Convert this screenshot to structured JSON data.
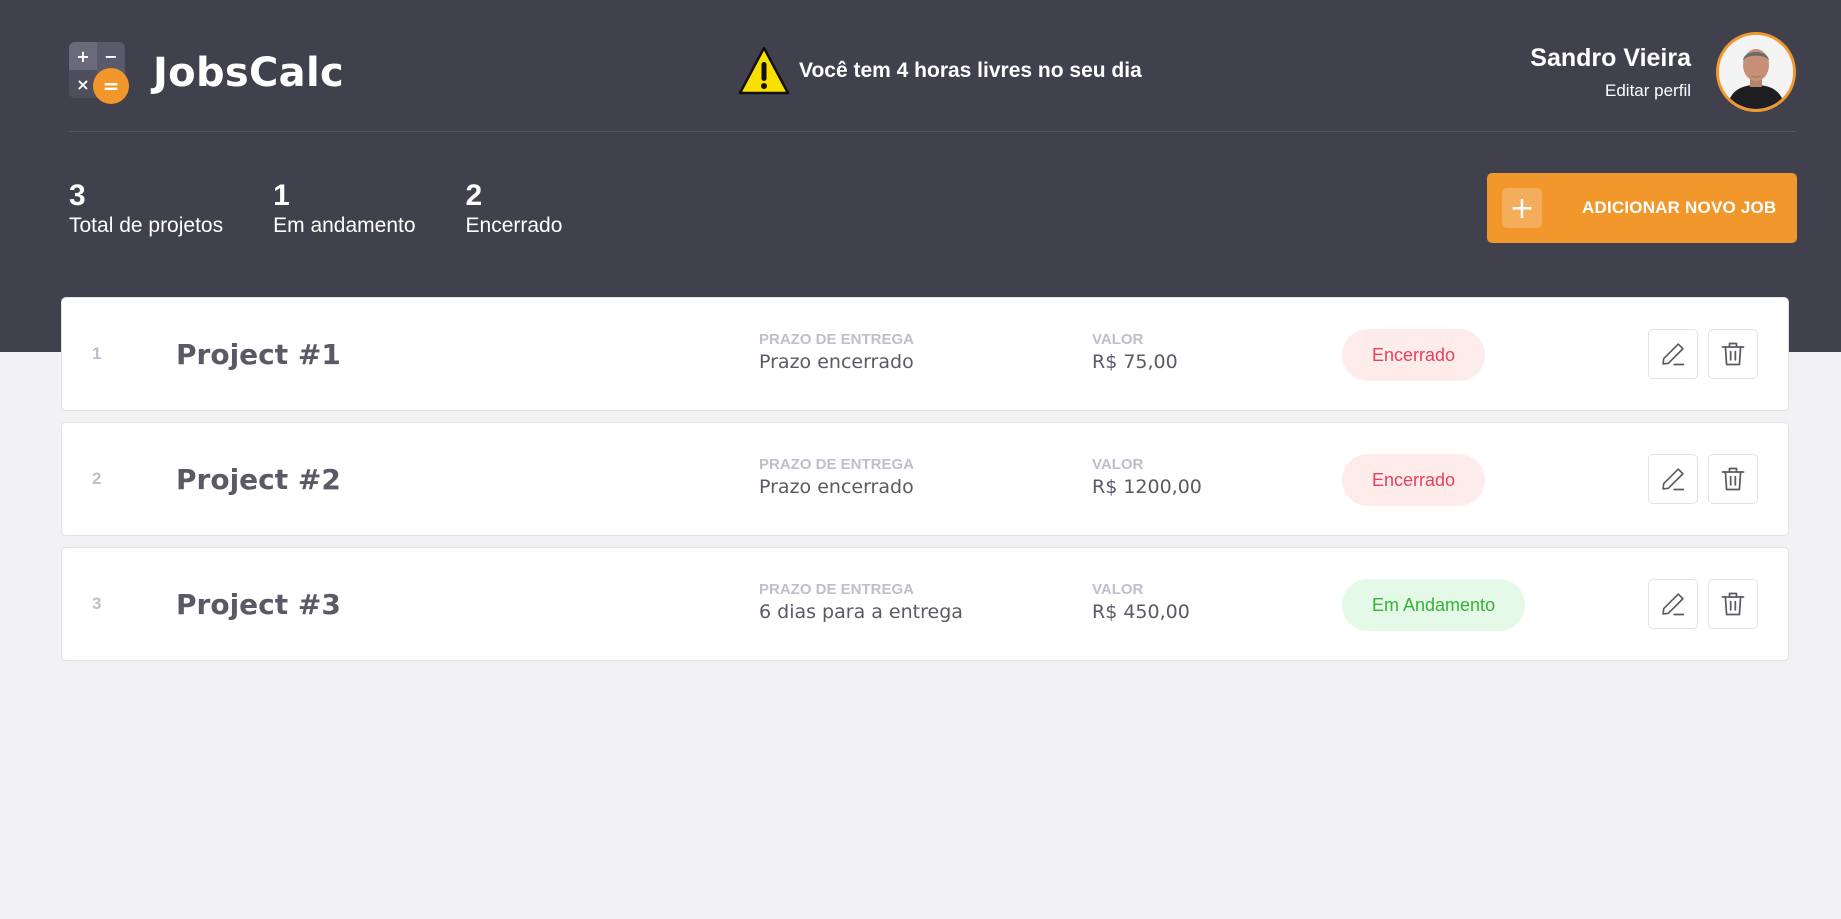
{
  "brand": {
    "name": "JobsCalc"
  },
  "alert": {
    "text": "Você tem 4 horas livres no seu dia"
  },
  "profile": {
    "name": "Sandro Vieira",
    "edit_label": "Editar perfil"
  },
  "summary": [
    {
      "value": "3",
      "label": "Total de projetos"
    },
    {
      "value": "1",
      "label": "Em andamento"
    },
    {
      "value": "2",
      "label": "Encerrado"
    }
  ],
  "actions": {
    "add_job_label": "ADICIONAR NOVO JOB"
  },
  "colors": {
    "header": "#41414d",
    "accent": "#f1972c",
    "closed": "#e83f5b",
    "in_progress": "#36b336"
  },
  "jobs": [
    {
      "id": "1",
      "name": "Project #1",
      "deadline_label": "PRAZO DE ENTREGA",
      "deadline": "Prazo encerrado",
      "value_label": "VALOR",
      "value": "R$ 75,00",
      "status": "Encerrado"
    },
    {
      "id": "2",
      "name": "Project #2",
      "deadline_label": "PRAZO DE ENTREGA",
      "deadline": "Prazo encerrado",
      "value_label": "VALOR",
      "value": "R$ 1200,00",
      "status": "Encerrado"
    },
    {
      "id": "3",
      "name": "Project #3",
      "deadline_label": "PRAZO DE ENTREGA",
      "deadline": "6 dias para a entrega",
      "value_label": "VALOR",
      "value": "R$ 450,00",
      "status": "Em Andamento"
    }
  ]
}
